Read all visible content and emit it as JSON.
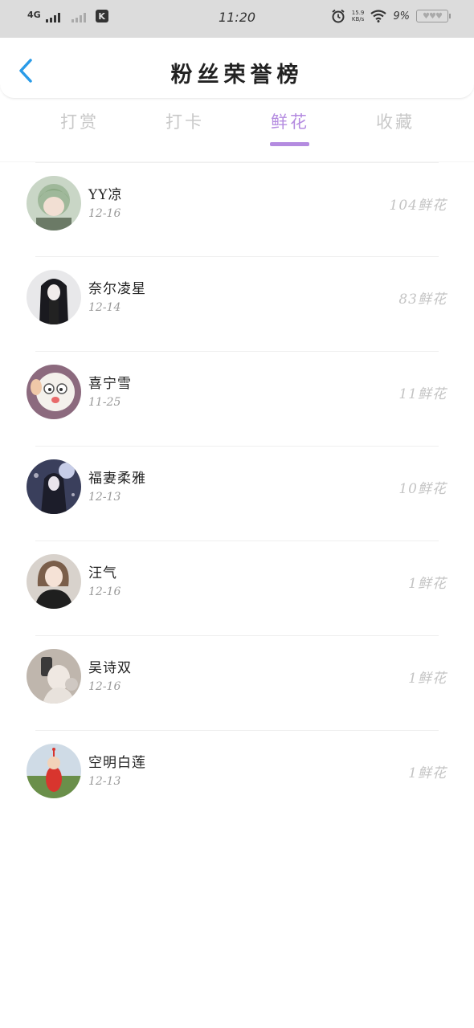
{
  "status_bar": {
    "network": "4G",
    "time": "11:20",
    "speed": "15.9",
    "speed_unit": "KB/s",
    "battery_pct": "9%",
    "alarm_icon": "alarm-icon",
    "wifi_icon": "wifi-icon"
  },
  "header": {
    "title": "粉丝荣誉榜",
    "back_icon": "chevron-left-icon",
    "accent_color": "#2a9be8"
  },
  "tabs": [
    {
      "label": "打赏",
      "active": false
    },
    {
      "label": "打卡",
      "active": false
    },
    {
      "label": "鲜花",
      "active": true
    },
    {
      "label": "收藏",
      "active": false
    }
  ],
  "tab_active_color": "#b48be0",
  "fans": [
    {
      "name": "YY凉",
      "date": "12-16",
      "amount": "104鲜花"
    },
    {
      "name": "奈尔凌星",
      "date": "12-14",
      "amount": "83鲜花"
    },
    {
      "name": "喜宁雪",
      "date": "11-25",
      "amount": "11鲜花"
    },
    {
      "name": "福妻柔雅",
      "date": "12-13",
      "amount": "10鲜花"
    },
    {
      "name": "汪气",
      "date": "12-16",
      "amount": "1鲜花"
    },
    {
      "name": "吴诗双",
      "date": "12-16",
      "amount": "1鲜花"
    },
    {
      "name": "空明白莲",
      "date": "12-13",
      "amount": "1鲜花"
    }
  ]
}
